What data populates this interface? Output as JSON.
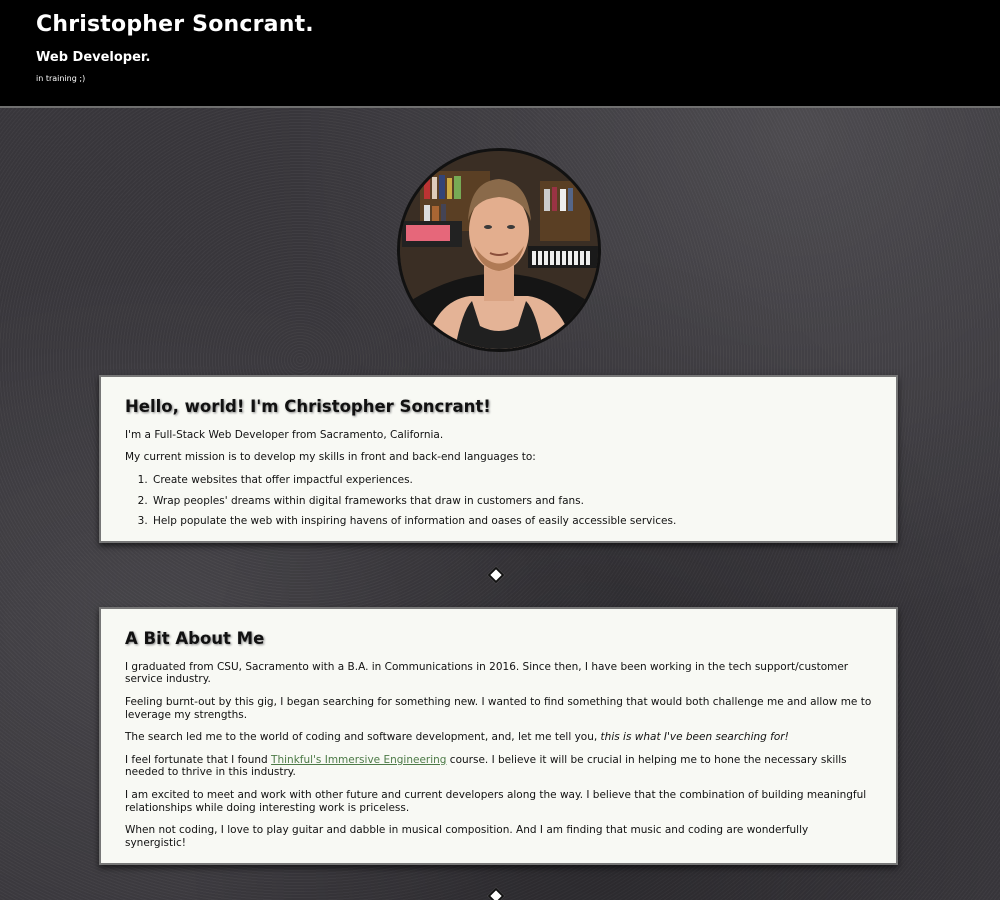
{
  "header": {
    "name": "Christopher Soncrant.",
    "role": "Web Developer.",
    "note": "in training ;)"
  },
  "hello": {
    "title": "Hello, world! I'm Christopher Soncrant!",
    "intro": "I'm a Full-Stack Web Developer from Sacramento, California.",
    "mission": "My current mission is to develop my skills in front and back-end languages to:",
    "goals": [
      "Create websites that offer impactful experiences.",
      "Wrap peoples' dreams within digital frameworks that draw in customers and fans.",
      "Help populate the web with inspiring havens of information and oases of easily accessible services."
    ]
  },
  "about": {
    "title": "A Bit About Me",
    "p1": "I graduated from CSU, Sacramento with a B.A. in Communications in 2016. Since then, I have been working in the tech support/customer service industry.",
    "p2": "Feeling burnt-out by this gig, I began searching for something new. I wanted to find something that would both challenge me and allow me to leverage my strengths.",
    "p3_start": "The search led me to the world of coding and software development, and, let me tell you, ",
    "p3_em": "this is what I've been searching for!",
    "p4_start": "I feel fortunate that I found ",
    "p4_link": "Thinkful's Immersive Engineering",
    "p4_end": " course. I believe it will be crucial in helping me to hone the necessary skills needed to thrive in this industry.",
    "p5": "I am excited to meet and work with other future and current developers along the way. I believe that the combination of building meaningful relationships while doing interesting work is priceless.",
    "p6": "When not coding, I love to play guitar and dabble in musical composition. And I am finding that music and coding are wonderfully synergistic!"
  },
  "colors": {
    "header_bg": "#000000",
    "card_bg": "#f8f9f4",
    "link": "#4c7a46"
  }
}
